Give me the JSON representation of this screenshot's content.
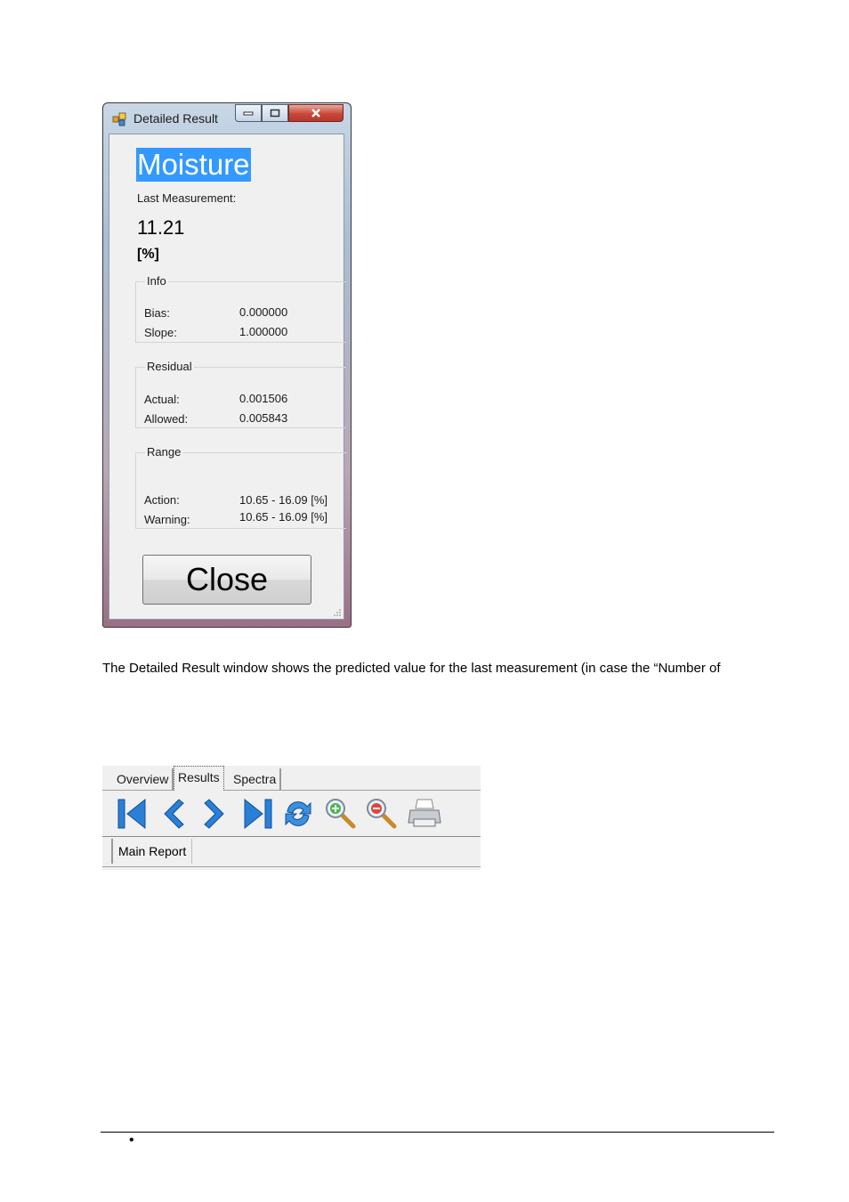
{
  "dialog": {
    "title": "Detailed Result",
    "component_name": "Moisture",
    "last_measurement_label": "Last Measurement:",
    "last_measurement_value": "11.21",
    "unit": "[%]",
    "info": {
      "title": "Info",
      "rows": [
        {
          "label": "Bias:",
          "value": "0.000000"
        },
        {
          "label": "Slope:",
          "value": "1.000000"
        }
      ]
    },
    "residual": {
      "title": "Residual",
      "rows": [
        {
          "label": "Actual:",
          "value": "0.001506"
        },
        {
          "label": "Allowed:",
          "value": "0.005843"
        }
      ]
    },
    "range": {
      "title": "Range",
      "rows": [
        {
          "label": "Action:",
          "value": "10.65 - 16.09 [%]"
        },
        {
          "label": "Warning:",
          "value": "10.65 - 16.09 [%]"
        }
      ]
    },
    "close_label": "Close",
    "window_controls": [
      "minimize-icon",
      "maximize-icon",
      "close-icon"
    ]
  },
  "paragraph": "The Detailed Result window shows the predicted value for the last measurement (in case the “Number of",
  "toolbar": {
    "tabs": [
      "Overview",
      "Results",
      "Spectra"
    ],
    "selected_tab": "Results",
    "icons": [
      "first-page-icon",
      "previous-page-icon",
      "next-page-icon",
      "last-page-icon",
      "refresh-icon",
      "zoom-in-icon",
      "zoom-out-icon",
      "print-icon"
    ],
    "sub_tab": "Main Report"
  },
  "footer": {
    "bullet": "•"
  }
}
